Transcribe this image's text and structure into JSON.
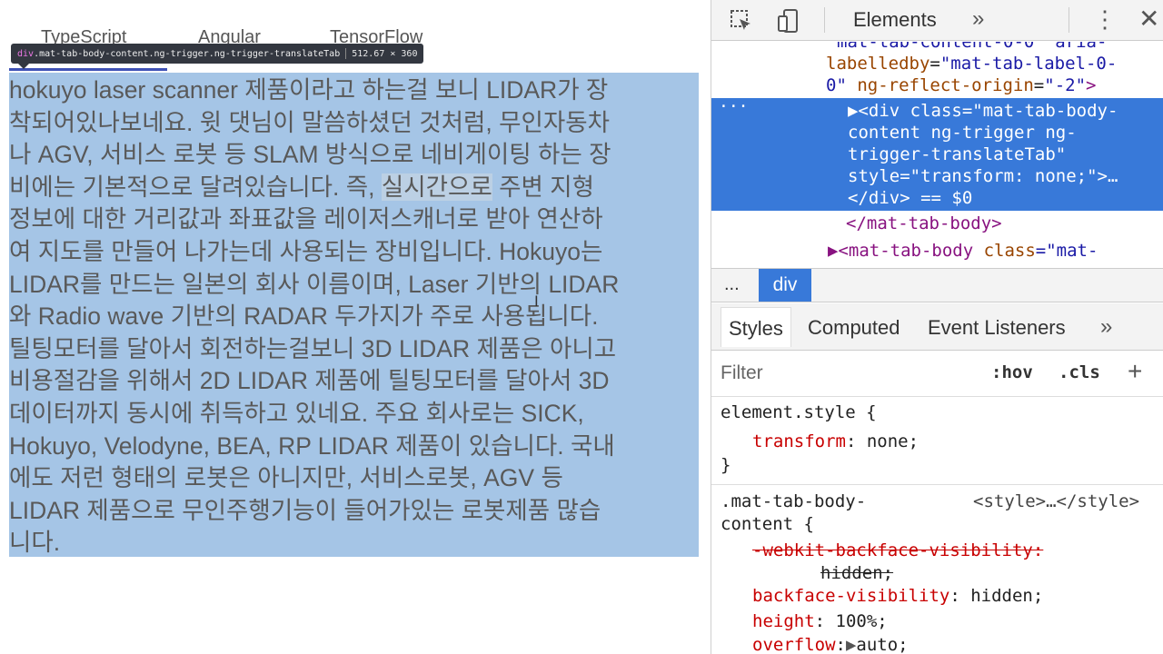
{
  "page": {
    "tabs": [
      "TypeScript",
      "Angular",
      "TensorFlow"
    ],
    "tooltip": {
      "tag": "div",
      "classes": ".mat-tab-body-content.ng-trigger.ng-trigger-translateTab",
      "size": "512.67 × 360"
    },
    "article_lines": [
      "hokuyo laser scanner 제품이라고 하는걸 보니 LIDAR가 장",
      "착되어있나보네요. 윗 댓님이 말씀하셨던 것처럼, 무인자동차",
      "나 AGV, 서비스 로봇 등 SLAM 방식으로 네비게이팅 하는 장",
      "비에는 기본적으로 달려있습니다. 즉, ",
      "실시간으로",
      " 주변 지형",
      "정보에 대한 거리값과 좌표값을 레이저스캐너로 받아 연산하",
      "여 지도를 만들어 나가는데 사용되는 장비입니다. Hokuyo는",
      "LIDAR를 만드는 일본의 회사 이름이며, Laser 기반의 LIDAR",
      "와 Radio wave 기반의 RADAR 두가지가 주로 사용됩니다.",
      "틸팅모터를 달아서 회전하는걸보니 3D LIDAR 제품은 아니고",
      "비용절감을 위해서 2D LIDAR 제품에 틸팅모터를 달아서 3D",
      "데이터까지 동시에 취득하고 있네요. 주요 회사로는 SICK,",
      "Hokuyo, Velodyne, BEA, RP LIDAR 제품이 있습니다. 국내",
      "에도 저런 형태의 로봇은 아니지만, 서비스로봇, AGV 등",
      "LIDAR 제품으로 무인주행기능이 들어가있는 로봇제품 많습",
      "니다."
    ]
  },
  "devtools": {
    "toolbar": {
      "elements_tab": "Elements",
      "more": "»",
      "menu": "⋮",
      "close": "✕"
    },
    "dom": {
      "line0": "mat-tab-content-0-0\" aria-",
      "line1_attr": "labelledby",
      "line1_val": "\"mat-tab-label-0-",
      "line2_val": "0\"",
      "line2_attr": " ng-reflect-origin",
      "line2_val2": "\"-2\"",
      "line2_close": ">",
      "sel_dots": "···",
      "sel1": "▶<div class=\"mat-tab-body-",
      "sel2": "content ng-trigger ng-",
      "sel3": "trigger-translateTab\"",
      "sel4": "style=\"transform: none;\">…",
      "sel5": "</div> == $0",
      "close_body": "</mat-tab-body>",
      "next_open": "▶<mat-tab-body ",
      "next_attr": "class",
      "next_val": "=\"mat-"
    },
    "breadcrumb": {
      "dots": "...",
      "current": "div"
    },
    "subtabs": {
      "styles": "Styles",
      "computed": "Computed",
      "event_listeners": "Event Listeners",
      "more": "»"
    },
    "filter": {
      "placeholder": "Filter",
      "hov": ":hov",
      "cls": ".cls",
      "add": "+"
    },
    "styles": {
      "element_style_selector": "element.style {",
      "element_prop": "transform",
      "element_val": "none;",
      "close_brace": "}",
      "rule_selector_1": ".mat-tab-body-",
      "rule_selector_2": "content {",
      "rule_source": "<style>…</style>",
      "prop1_name": "-webkit-backface-visibility:",
      "prop1_val": "hidden;",
      "prop2_name": "backface-visibility",
      "prop2_val": "hidden;",
      "prop3_name": "height",
      "prop3_val": "100%;",
      "prop4_name": "overflow",
      "prop4_val": "auto;"
    }
  }
}
